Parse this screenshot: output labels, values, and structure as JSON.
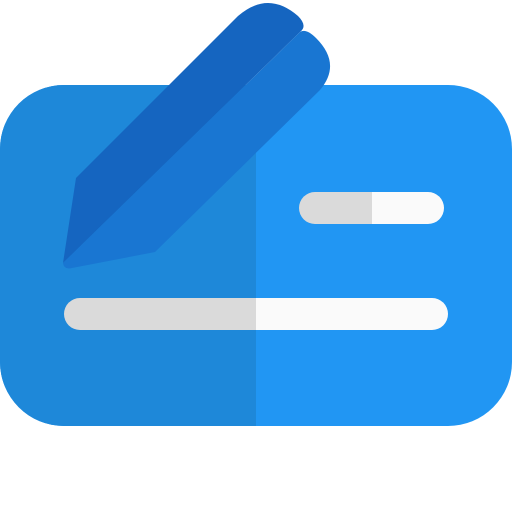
{
  "icon": {
    "name": "signed-cheque-icon",
    "colors": {
      "card_left": "#1E88D9",
      "card_right": "#2196F3",
      "pen_dark": "#1565C0",
      "pen_light": "#1976D2",
      "line_gray": "#DADADA",
      "line_white": "#FAFAFA"
    }
  }
}
